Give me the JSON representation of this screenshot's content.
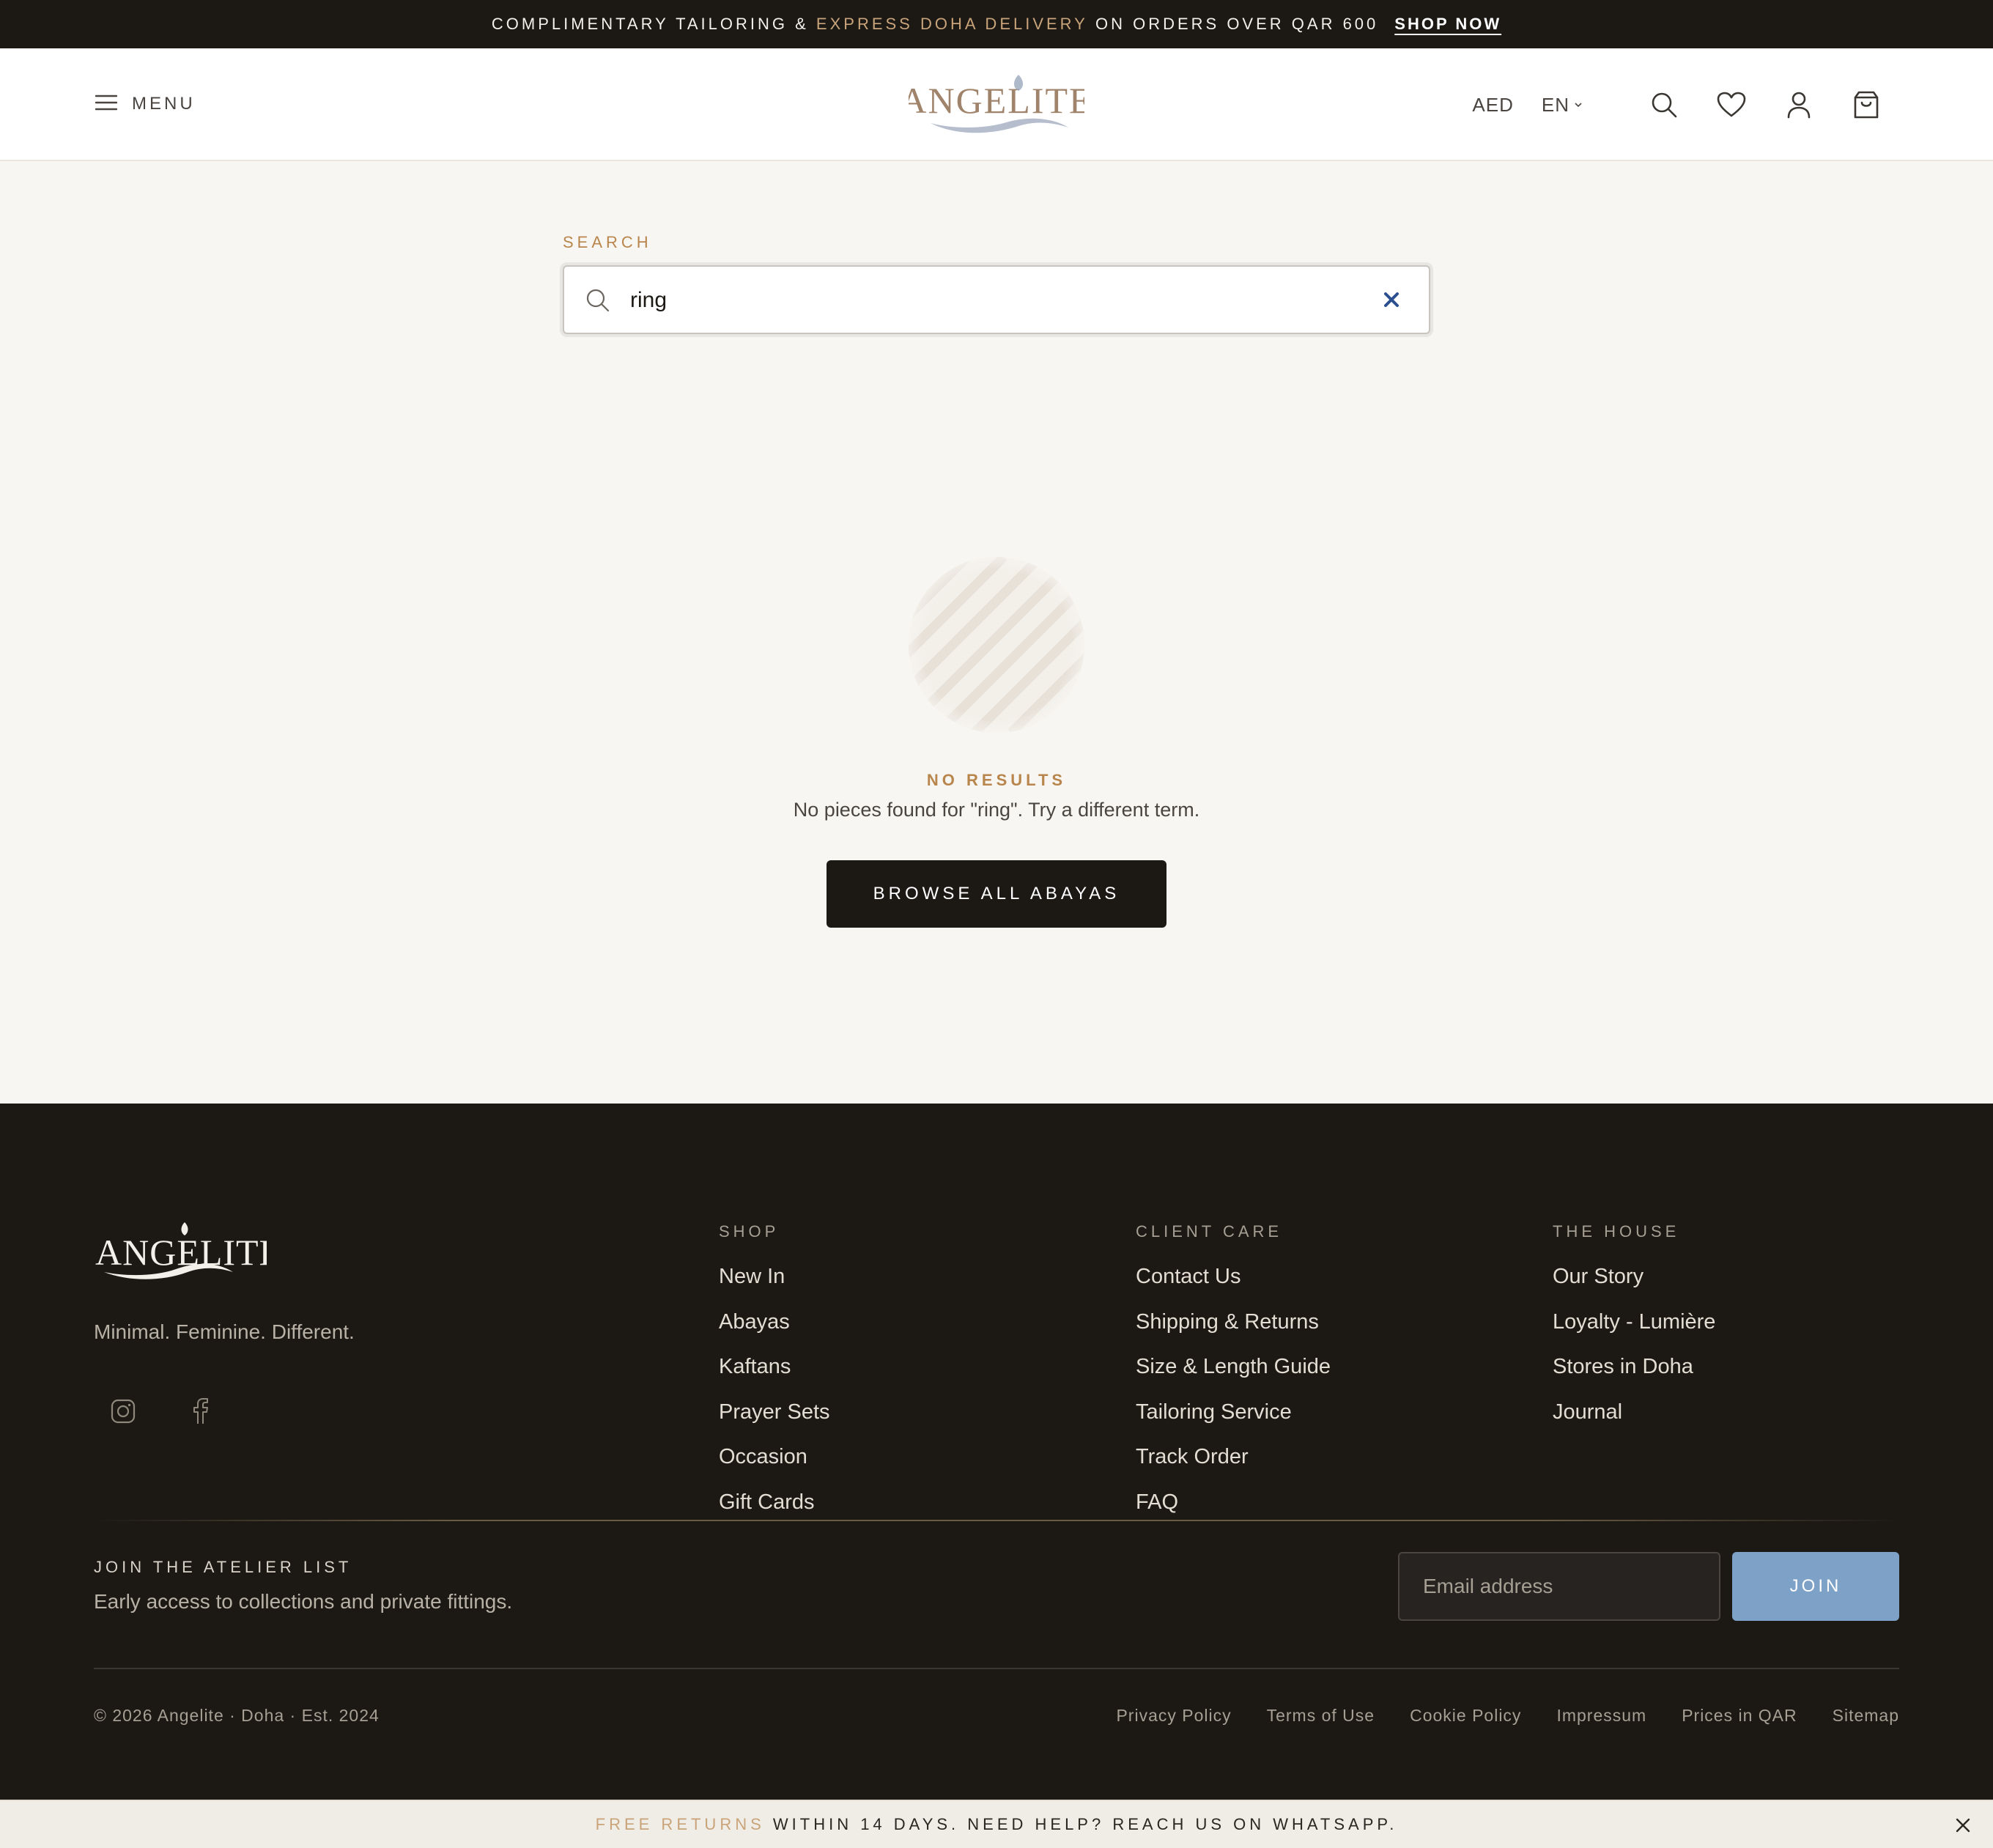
{
  "announcement": {
    "text_before": "COMPLIMENTARY TAILORING & ",
    "highlight": "EXPRESS DOHA DELIVERY",
    "text_after": " ON ORDERS OVER QAR 600",
    "cta": "SHOP NOW"
  },
  "header": {
    "menu_label": "MENU",
    "logo_text": "ANGELITE",
    "currency": "AED",
    "language": "EN",
    "icons": [
      "search-icon",
      "heart-icon",
      "account-icon",
      "bag-icon"
    ]
  },
  "search": {
    "label": "SEARCH",
    "query": "ring"
  },
  "empty_state": {
    "label": "NO RESULTS",
    "message": "No pieces found for \"ring\". Try a different term.",
    "button": "BROWSE ALL ABAYAS"
  },
  "footer": {
    "logo_text": "ANGELITE",
    "tagline": "Minimal. Feminine. Different.",
    "social": [
      "instagram-icon",
      "facebook-icon"
    ],
    "columns": [
      {
        "title": "SHOP",
        "links": [
          "New In",
          "Abayas",
          "Kaftans",
          "Prayer Sets",
          "Occasion",
          "Gift Cards"
        ]
      },
      {
        "title": "CLIENT CARE",
        "links": [
          "Contact Us",
          "Shipping & Returns",
          "Size & Length Guide",
          "Tailoring Service",
          "Track Order",
          "FAQ"
        ]
      },
      {
        "title": "THE HOUSE",
        "links": [
          "Our Story",
          "Loyalty - Lumière",
          "Stores in Doha",
          "Journal"
        ]
      }
    ],
    "newsletter": {
      "title": "JOIN THE ATELIER LIST",
      "subtitle": "Early access to collections and private fittings.",
      "placeholder": "Email address",
      "button": "JOIN"
    },
    "copyright": "© 2026 Angelite · Doha · Est. 2024",
    "legal_links": [
      "Privacy Policy",
      "Terms of Use",
      "Cookie Policy",
      "Impressum",
      "Prices in QAR",
      "Sitemap"
    ]
  },
  "notice": {
    "highlight": "FREE RETURNS",
    "text": " WITHIN 14 DAYS. NEED HELP? REACH US ON WHATSAPP."
  },
  "colors": {
    "dark": "#1c1915",
    "gold": "#c9a47a",
    "label_gold": "#b8864c",
    "background": "#f8f6f2",
    "join_blue": "#7ea1c7",
    "clear_blue": "#2c4f8f"
  }
}
